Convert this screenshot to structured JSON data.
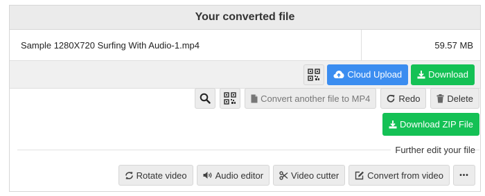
{
  "header": {
    "title": "Your converted file"
  },
  "file": {
    "name": "Sample 1280X720 Surfing With Audio-1.mp4",
    "size": "59.57 MB"
  },
  "download_row": {
    "qr_icon": "qr-code-icon",
    "cloud_upload_label": "Cloud Upload",
    "download_label": "Download"
  },
  "actions": {
    "search_icon": "search-icon",
    "qr_icon": "qr-code-icon",
    "convert_another_label": "Convert another file to MP4",
    "redo_label": "Redo",
    "delete_label": "Delete"
  },
  "zip": {
    "label": "Download ZIP File"
  },
  "edit": {
    "heading": "Further edit your file",
    "rotate_label": "Rotate video",
    "audio_label": "Audio editor",
    "cutter_label": "Video cutter",
    "convert_from_label": "Convert from video",
    "more_label": "•••"
  },
  "colors": {
    "blue": "#3b8df0",
    "green": "#14c155",
    "gray_button": "#ececec"
  }
}
